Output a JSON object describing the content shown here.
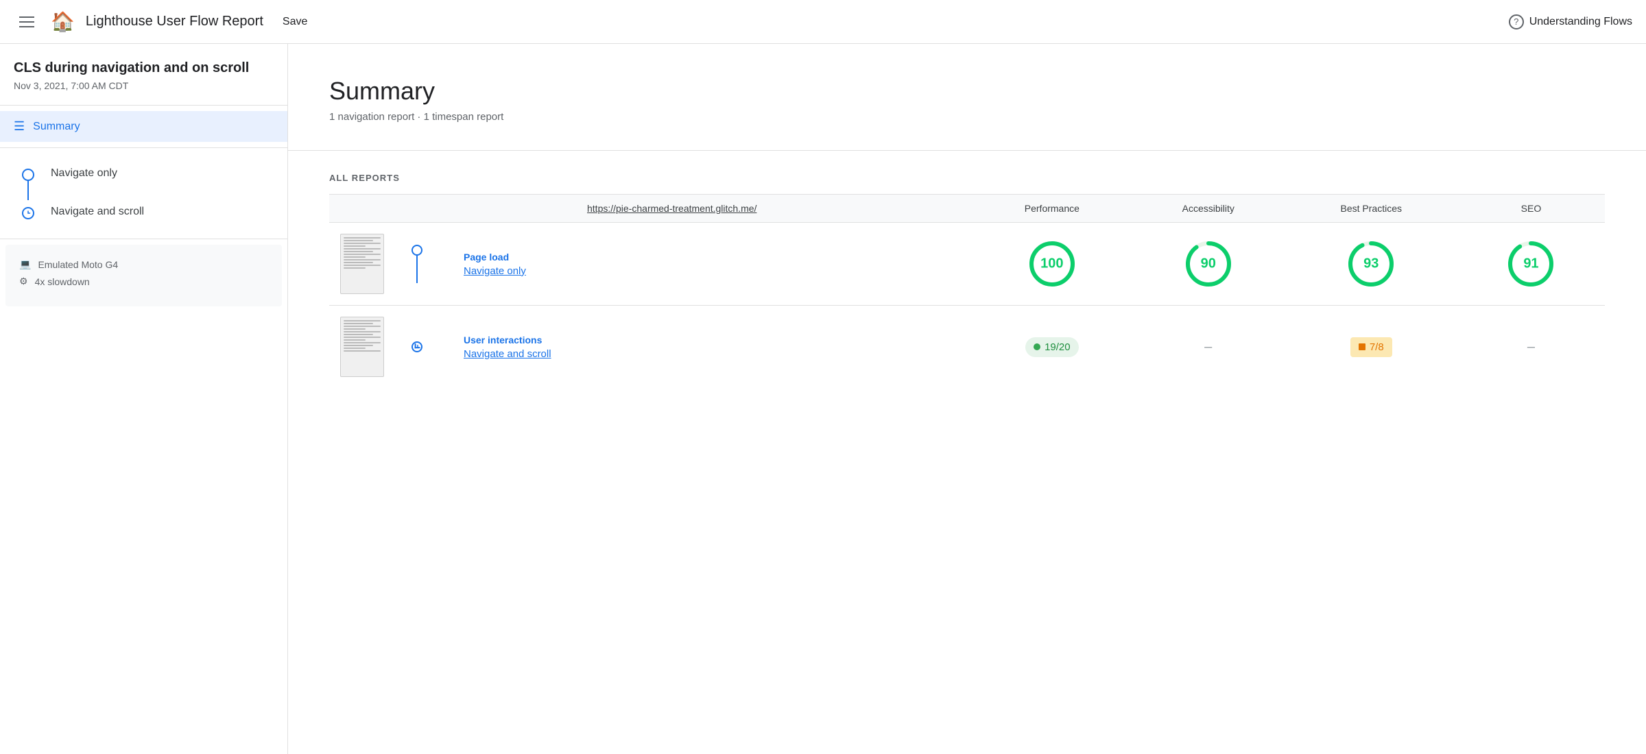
{
  "header": {
    "title": "Lighthouse User Flow Report",
    "save_label": "Save",
    "understanding_flows": "Understanding Flows"
  },
  "sidebar": {
    "project_title": "CLS during navigation and on scroll",
    "project_date": "Nov 3, 2021, 7:00 AM CDT",
    "nav": {
      "summary_label": "Summary"
    },
    "flows": [
      {
        "label": "Navigate only",
        "type": "circle"
      },
      {
        "label": "Navigate and scroll",
        "type": "clock"
      }
    ],
    "device": "Emulated Moto G4",
    "slowdown": "4x slowdown"
  },
  "content": {
    "summary_heading": "Summary",
    "summary_sub": "1 navigation report · 1 timespan report",
    "all_reports_label": "ALL REPORTS",
    "url_col": "https://pie-charmed-treatment.glitch.me/",
    "col_performance": "Performance",
    "col_accessibility": "Accessibility",
    "col_best_practices": "Best Practices",
    "col_seo": "SEO",
    "reports": [
      {
        "type": "Page load",
        "name": "Navigate only",
        "connector": "circle",
        "performance": "100",
        "accessibility": "90",
        "best_practices": "93",
        "seo": "91",
        "perf_type": "circle",
        "acc_type": "circle",
        "bp_type": "circle",
        "seo_type": "circle"
      },
      {
        "type": "User interactions",
        "name": "Navigate and scroll",
        "connector": "clock",
        "performance_pill": "19/20",
        "accessibility_dash": "–",
        "best_practices_pill": "7/8",
        "seo_dash": "–"
      }
    ]
  }
}
